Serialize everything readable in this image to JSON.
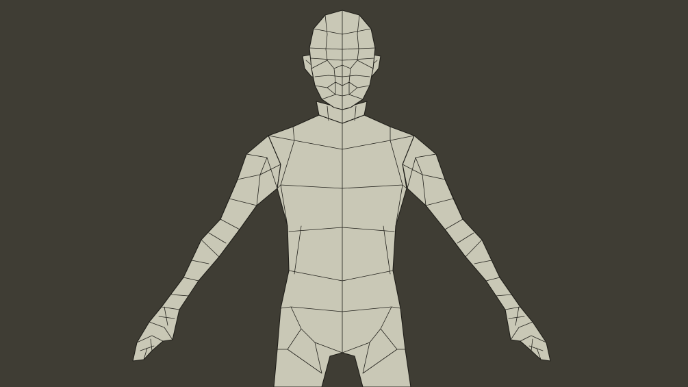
{
  "scene": {
    "subject": "low-poly-character-mesh",
    "colors": {
      "background": "#3f3d34",
      "mesh_surface": "#c9c8b6",
      "wireframe": "#1f1e19"
    }
  }
}
